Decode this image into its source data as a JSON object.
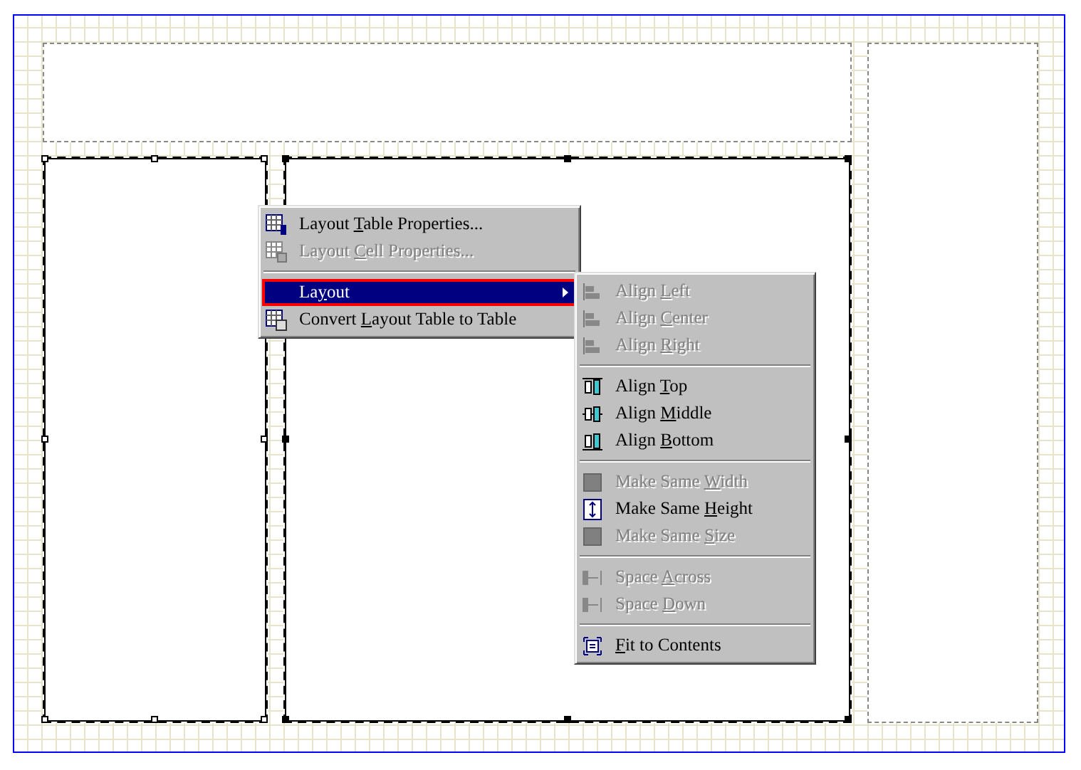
{
  "context_menu": {
    "items": [
      {
        "kind": "item",
        "label": {
          "before": "Layout ",
          "key": "T",
          "after": "able Properties..."
        },
        "disabled": false,
        "selected": false
      },
      {
        "kind": "item",
        "label": {
          "before": "Layout ",
          "key": "C",
          "after": "ell Properties..."
        },
        "disabled": true,
        "selected": false
      },
      {
        "kind": "separator"
      },
      {
        "kind": "submenu",
        "label": {
          "before": "La",
          "key": "y",
          "after": "out"
        },
        "disabled": false,
        "selected": true
      },
      {
        "kind": "item",
        "label": {
          "before": "Convert ",
          "key": "L",
          "after": "ayout Table to Table"
        },
        "disabled": false,
        "selected": false
      }
    ]
  },
  "submenu": {
    "items": [
      {
        "kind": "item",
        "label": {
          "before": "Align ",
          "key": "L",
          "after": "eft"
        },
        "disabled": true,
        "selected": false
      },
      {
        "kind": "item",
        "label": {
          "before": "Align ",
          "key": "C",
          "after": "enter"
        },
        "disabled": true,
        "selected": false
      },
      {
        "kind": "item",
        "label": {
          "before": "Align ",
          "key": "R",
          "after": "ight"
        },
        "disabled": true,
        "selected": false
      },
      {
        "kind": "separator"
      },
      {
        "kind": "item",
        "label": {
          "before": "Align ",
          "key": "T",
          "after": "op"
        },
        "disabled": false,
        "selected": false
      },
      {
        "kind": "item",
        "label": {
          "before": "Align ",
          "key": "M",
          "after": "iddle"
        },
        "disabled": false,
        "selected": false
      },
      {
        "kind": "item",
        "label": {
          "before": "Align ",
          "key": "B",
          "after": "ottom"
        },
        "disabled": false,
        "selected": false
      },
      {
        "kind": "separator"
      },
      {
        "kind": "item",
        "label": {
          "before": "Make Same ",
          "key": "W",
          "after": "idth"
        },
        "disabled": true,
        "selected": false
      },
      {
        "kind": "item",
        "label": {
          "before": "Make Same ",
          "key": "H",
          "after": "eight"
        },
        "disabled": false,
        "selected": false
      },
      {
        "kind": "item",
        "label": {
          "before": "Make Same ",
          "key": "S",
          "after": "ize"
        },
        "disabled": true,
        "selected": false
      },
      {
        "kind": "separator"
      },
      {
        "kind": "item",
        "label": {
          "before": "Space ",
          "key": "A",
          "after": "cross"
        },
        "disabled": true,
        "selected": false
      },
      {
        "kind": "item",
        "label": {
          "before": "Space ",
          "key": "D",
          "after": "own"
        },
        "disabled": true,
        "selected": false
      },
      {
        "kind": "separator"
      },
      {
        "kind": "item",
        "label": {
          "key": "F",
          "after": "it to Contents"
        },
        "disabled": false,
        "selected": false
      }
    ]
  }
}
